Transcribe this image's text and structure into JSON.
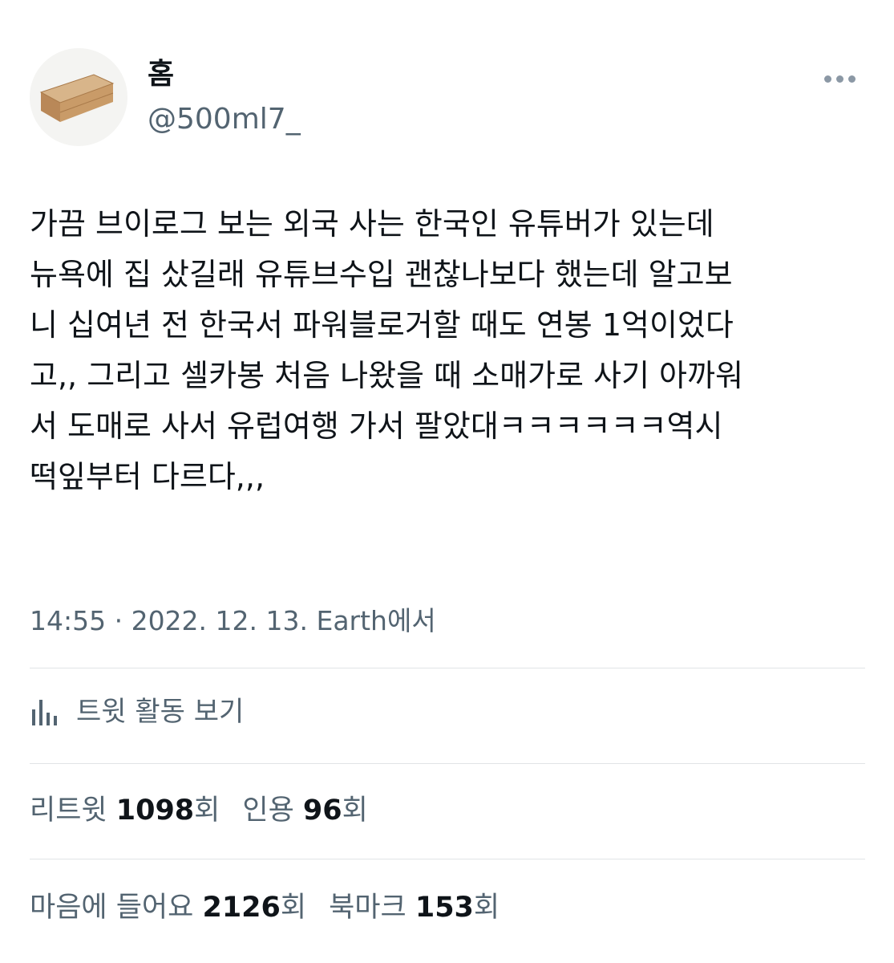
{
  "author": {
    "name": "홈",
    "handle": "@500ml7_"
  },
  "tweet": {
    "text": "가끔 브이로그 보는 외국 사는 한국인 유튜버가 있는데\n뉴욕에 집 샀길래 유튜브수입 괜찮나보다 했는데 알고보\n니 십여년 전 한국서 파워블로거할 때도 연봉 1억이었다\n고,, 그리고 셀카봉 처음 나왔을 때 소매가로 사기 아까워\n서 도매로 사서 유럽여행 가서 팔았대ㅋㅋㅋㅋㅋㅋ역시\n떡잎부터 다르다,,,",
    "meta": "14:55 · 2022. 12. 13. Earth에서"
  },
  "activity": {
    "label": "트윗 활동 보기",
    "icon": "analytics-icon"
  },
  "stats": {
    "retweets_label": "리트윗",
    "retweets_count": "1098",
    "quotes_label": "인용",
    "quotes_count": "96",
    "likes_label": "마음에 들어요",
    "likes_count": "2126",
    "bookmarks_label": "북마크",
    "bookmarks_count": "153",
    "unit": "회"
  },
  "colors": {
    "text": "#0f1419",
    "secondary": "#536471",
    "divider": "#e1e4e6"
  }
}
